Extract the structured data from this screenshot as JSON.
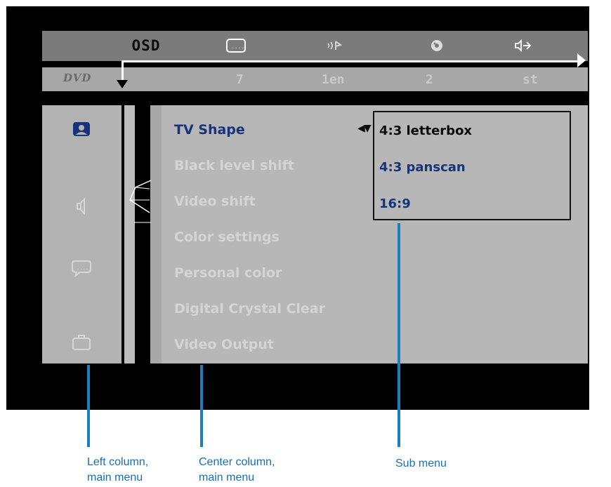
{
  "icon_bar": {
    "osd_label": "OSD",
    "icons": [
      "subtitle-icon",
      "audio-language-icon",
      "angle-icon",
      "sound-mode-icon"
    ]
  },
  "status_row": {
    "logo_text": "DVD",
    "values": [
      "7",
      "1en",
      "2",
      "st"
    ]
  },
  "left_column": {
    "icons": [
      "picture-icon",
      "speaker-icon",
      "speech-bubble-icon",
      "suitcase-icon"
    ]
  },
  "menu": {
    "items": [
      {
        "label": "TV Shape",
        "active": true
      },
      {
        "label": "Black level shift",
        "active": false
      },
      {
        "label": "Video shift",
        "active": false
      },
      {
        "label": "Color settings",
        "active": false
      },
      {
        "label": "Personal color",
        "active": false
      },
      {
        "label": "Digital Crystal Clear",
        "active": false
      },
      {
        "label": "Video Output",
        "active": false
      }
    ]
  },
  "submenu": {
    "items": [
      "4:3 letterbox",
      "4:3 panscan",
      "16:9"
    ],
    "selected": "4:3 letterbox"
  },
  "callouts": {
    "left": "Left column, main menu",
    "left_line1": "Left column,",
    "left_line2": "main menu",
    "center_line1": "Center column,",
    "center_line2": "main menu",
    "sub": "Sub menu"
  },
  "colors": {
    "accent_text": "#17337a",
    "callout": "#1570b6"
  }
}
